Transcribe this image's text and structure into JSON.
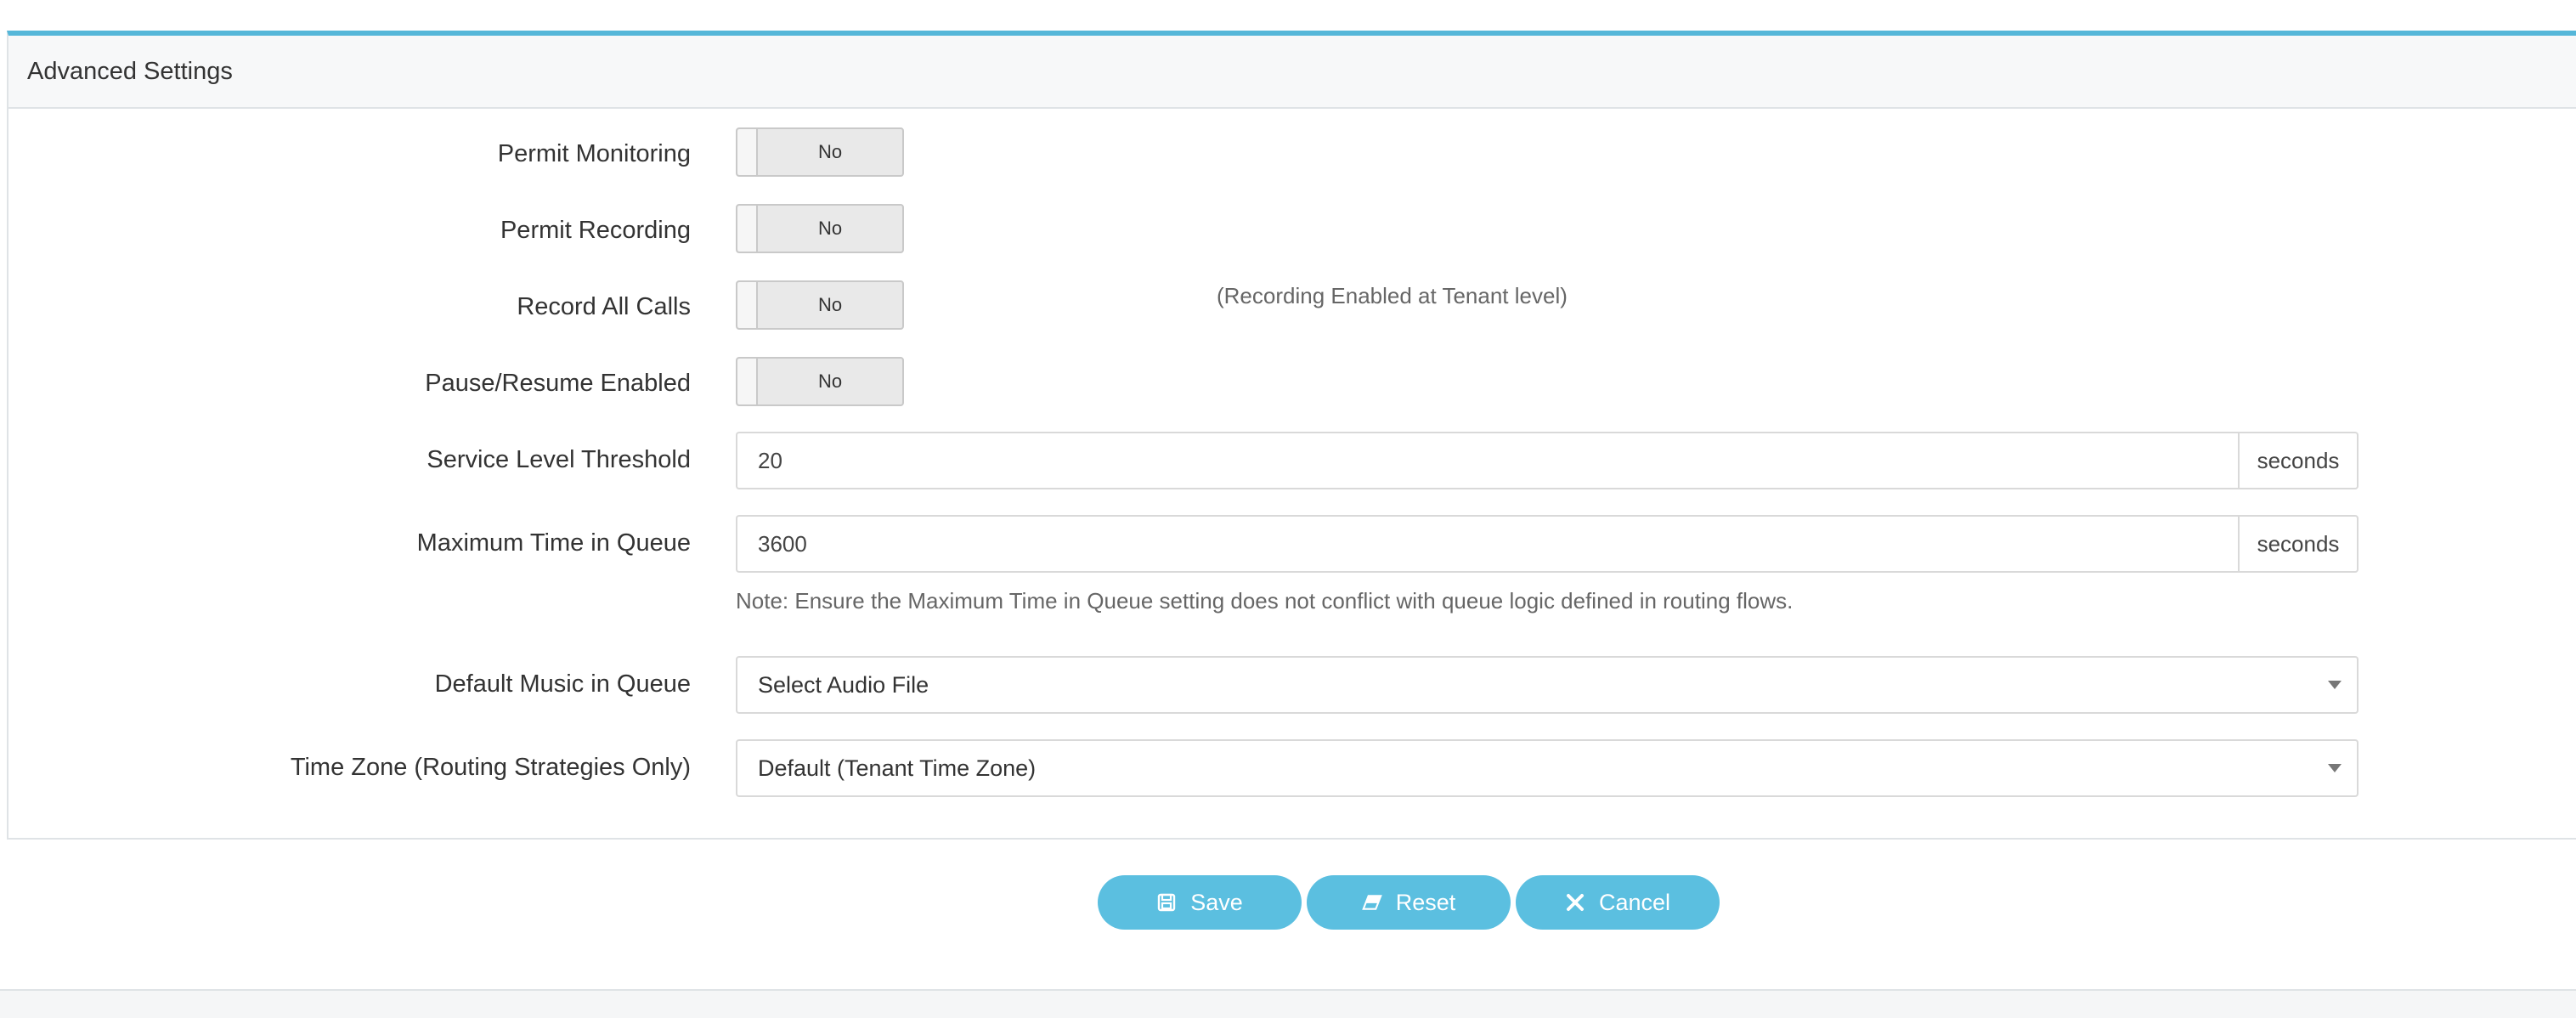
{
  "panel": {
    "title": "Advanced Settings"
  },
  "fields": {
    "permit_monitoring": {
      "label": "Permit Monitoring",
      "value": "No"
    },
    "permit_recording": {
      "label": "Permit Recording",
      "value": "No"
    },
    "record_all_calls": {
      "label": "Record All Calls",
      "value": "No",
      "side_note": "(Recording Enabled at Tenant level)"
    },
    "pause_resume": {
      "label": "Pause/Resume Enabled",
      "value": "No"
    },
    "service_level_threshold": {
      "label": "Service Level Threshold",
      "value": "20",
      "unit": "seconds"
    },
    "max_time_in_queue": {
      "label": "Maximum Time in Queue",
      "value": "3600",
      "unit": "seconds",
      "note": "Note: Ensure the Maximum Time in Queue setting does not conflict with queue logic defined in routing flows."
    },
    "default_music": {
      "label": "Default Music in Queue",
      "value": "Select Audio File"
    },
    "time_zone": {
      "label": "Time Zone (Routing Strategies Only)",
      "value": "Default (Tenant Time Zone)"
    }
  },
  "actions": {
    "save": "Save",
    "reset": "Reset",
    "cancel": "Cancel"
  },
  "colors": {
    "accent": "#5bbfe0",
    "panel_border_top": "#56b7d9"
  },
  "icons": {
    "save": "save-icon",
    "reset": "eraser-icon",
    "cancel": "close-icon"
  }
}
